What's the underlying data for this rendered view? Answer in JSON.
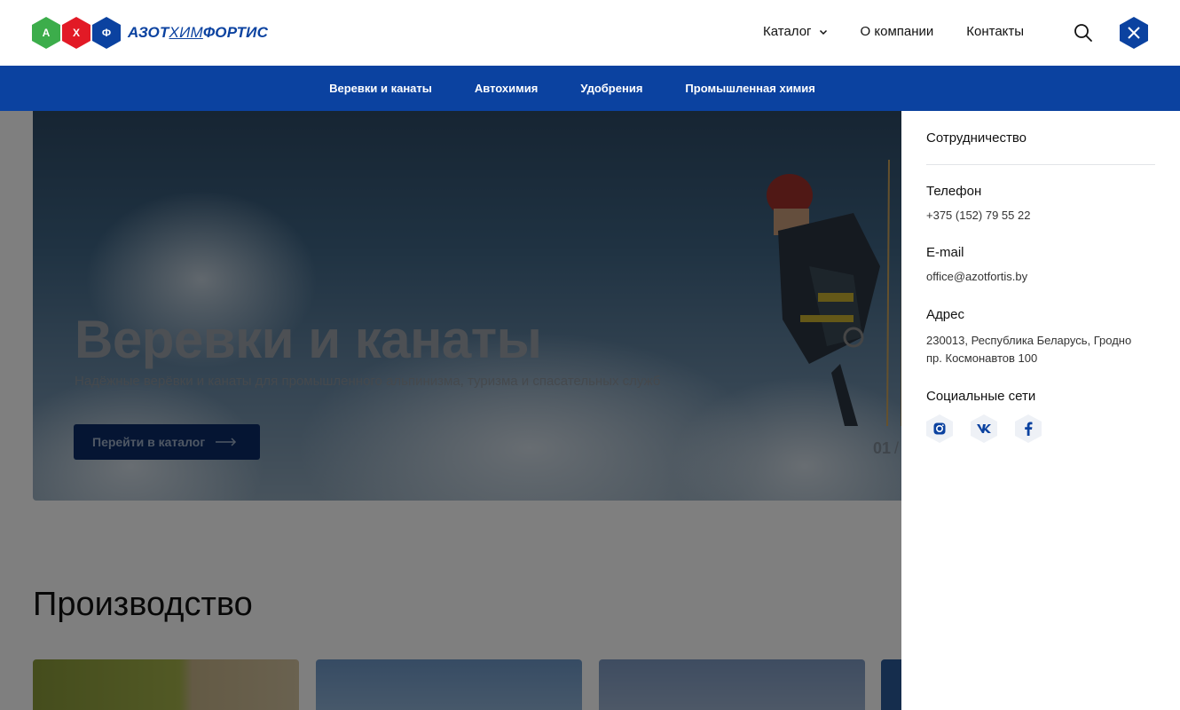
{
  "header": {
    "logo_letters": [
      "А",
      "Х",
      "Ф"
    ],
    "logo_text_part1": "АЗОТ",
    "logo_text_part2": "ХИМ",
    "logo_text_part3": "ФОРТИС",
    "nav": {
      "catalog": "Каталог",
      "about": "О компании",
      "contacts": "Контакты"
    }
  },
  "subnav": {
    "items": [
      "Веревки и канаты",
      "Автохимия",
      "Удобрения",
      "Промышленная химия"
    ]
  },
  "hero": {
    "title": "Веревки и канаты",
    "subtitle": "Надёжные верёвки и канаты для промышленного альпинизма, туризма и спасательных служб",
    "button": "Перейти в каталог",
    "slide_current": "01",
    "slide_sep": "/"
  },
  "section": {
    "title": "Производство"
  },
  "panel": {
    "cooperation": "Сотрудничество",
    "phone_label": "Телефон",
    "phone": "+375 (152) 79 55 22",
    "email_label": "E-mail",
    "email": "office@azotfortis.by",
    "address_label": "Адрес",
    "address_line1": "230013, Республика Беларусь, Гродно",
    "address_line2": "пр. Космонавтов 100",
    "social_label": "Социальные сети"
  },
  "colors": {
    "brand_blue": "#0b42a0",
    "brand_green": "#3cad4b",
    "brand_red": "#e21a26"
  },
  "icons": [
    "search-icon",
    "close-icon",
    "chevron-down-icon",
    "arrow-right-icon",
    "instagram-icon",
    "vk-icon",
    "facebook-icon"
  ]
}
